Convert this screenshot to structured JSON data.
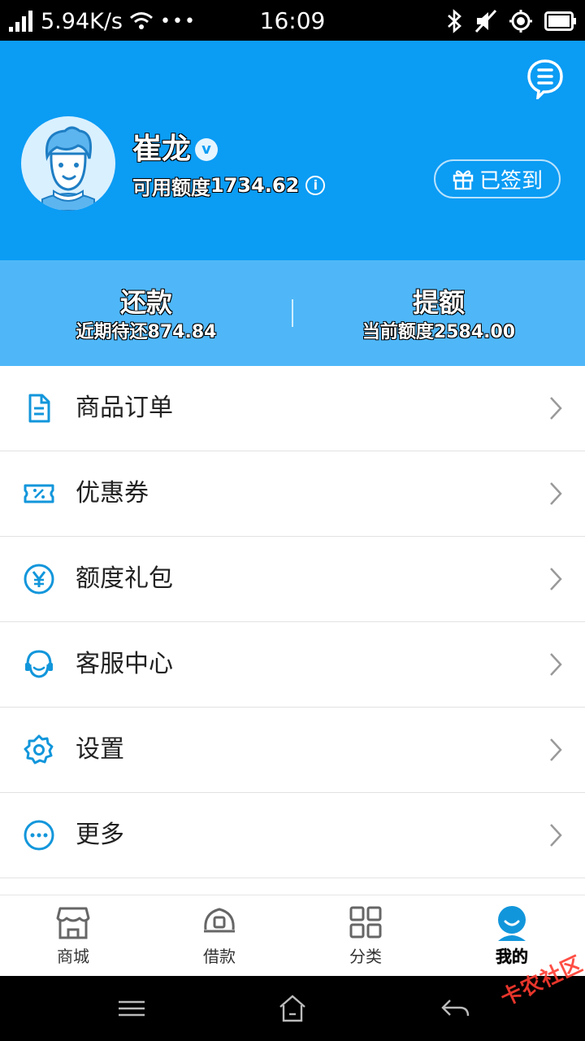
{
  "status_bar": {
    "speed": "5.94K/s",
    "dots": "•••",
    "time": "16:09"
  },
  "profile": {
    "name": "崔龙",
    "verified_badge": "v",
    "credit_label": "可用额度",
    "credit_value": "1734.62",
    "info": "i",
    "sign_label": "已签到"
  },
  "stats": {
    "left": {
      "title": "还款",
      "sub_label": "近期待还",
      "sub_value": "874.84"
    },
    "right": {
      "title": "提额",
      "sub_label": "当前额度",
      "sub_value": "2584.00"
    }
  },
  "menu": {
    "items": [
      {
        "label": "商品订单",
        "icon": "document-icon"
      },
      {
        "label": "优惠券",
        "icon": "coupon-icon"
      },
      {
        "label": "额度礼包",
        "icon": "yen-icon"
      },
      {
        "label": "客服中心",
        "icon": "headset-icon"
      },
      {
        "label": "设置",
        "icon": "gear-icon"
      },
      {
        "label": "更多",
        "icon": "more-icon"
      }
    ]
  },
  "tabbar": {
    "tabs": [
      {
        "label": "商城",
        "icon": "store-icon"
      },
      {
        "label": "借款",
        "icon": "coin-icon"
      },
      {
        "label": "分类",
        "icon": "grid-icon"
      },
      {
        "label": "我的",
        "icon": "profile-icon",
        "active": true
      }
    ]
  },
  "watermark": "卡农社区",
  "colors": {
    "primary": "#0b9cf4",
    "stats_bg": "#4fb7f8",
    "icon_blue": "#1296db"
  }
}
